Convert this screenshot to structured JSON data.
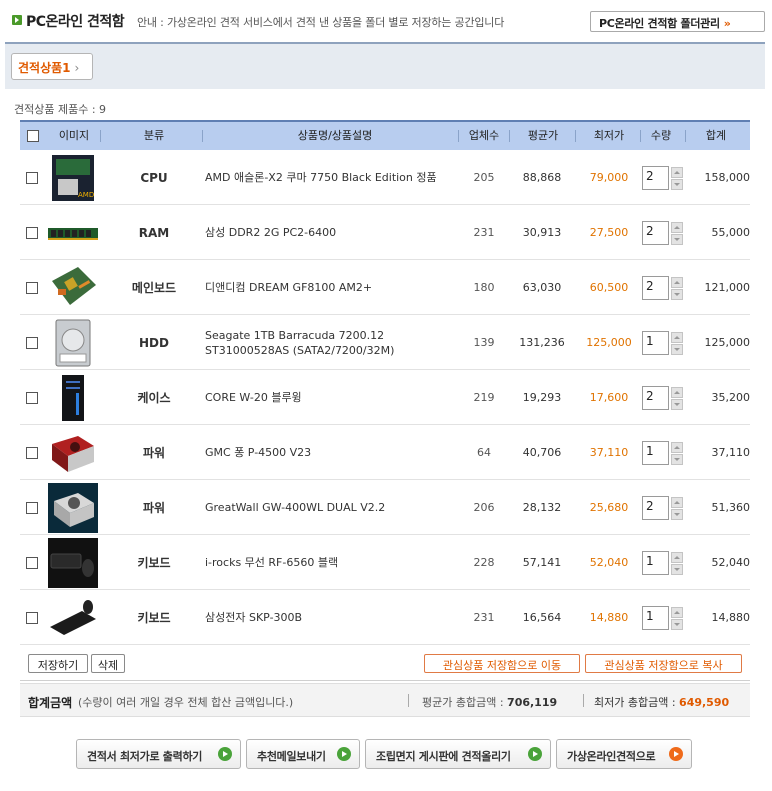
{
  "header": {
    "title": "PC온라인 견적함",
    "notice": "안내 : 가상온라인 견적 서비스에서 견적 낸 상품을 폴더 별로 저장하는 공간입니다",
    "folder_button": "PC온라인 견적함 폴더관리",
    "folder_button_chevron": "»"
  },
  "tabs": [
    {
      "label": "견적상품1",
      "chevron": "›",
      "active": true
    }
  ],
  "count_label": "견적상품 제품수 : 9",
  "table": {
    "columns": [
      "이미지",
      "분류",
      "상품명/상품설명",
      "업체수",
      "평균가",
      "최저가",
      "수량",
      "합계"
    ],
    "rows": [
      {
        "image": "cpu-box-image",
        "category": "CPU",
        "name": "AMD 애슬론-X2 쿠마 7750 Black Edition 정품",
        "vendors": "205",
        "avg": "88,868",
        "low": "79,000",
        "qty": "2",
        "total": "158,000"
      },
      {
        "image": "ram-stick-image",
        "category": "RAM",
        "name": "삼성 DDR2 2G PC2-6400",
        "vendors": "231",
        "avg": "30,913",
        "low": "27,500",
        "qty": "2",
        "total": "55,000"
      },
      {
        "image": "mainboard-image",
        "category": "메인보드",
        "name": "디앤디컴 DREAM GF8100 AM2+",
        "vendors": "180",
        "avg": "63,030",
        "low": "60,500",
        "qty": "2",
        "total": "121,000"
      },
      {
        "image": "hdd-image",
        "category": "HDD",
        "name": "Seagate 1TB Barracuda 7200.12 ST31000528AS (SATA2/7200/32M)",
        "vendors": "139",
        "avg": "131,236",
        "low": "125,000",
        "qty": "1",
        "total": "125,000"
      },
      {
        "image": "pc-case-image",
        "category": "케이스",
        "name": "CORE W-20 블루윙",
        "vendors": "219",
        "avg": "19,293",
        "low": "17,600",
        "qty": "2",
        "total": "35,200"
      },
      {
        "image": "psu-image",
        "category": "파워",
        "name": "GMC 퐁 P-4500 V23",
        "vendors": "64",
        "avg": "40,706",
        "low": "37,110",
        "qty": "1",
        "total": "37,110"
      },
      {
        "image": "psu-image-2",
        "category": "파워",
        "name": "GreatWall GW-400WL DUAL V2.2",
        "vendors": "206",
        "avg": "28,132",
        "low": "25,680",
        "qty": "2",
        "total": "51,360"
      },
      {
        "image": "keyboard-mouse-image",
        "category": "키보드",
        "name": "i-rocks 무선 RF-6560 블랙",
        "vendors": "228",
        "avg": "57,141",
        "low": "52,040",
        "qty": "1",
        "total": "52,040"
      },
      {
        "image": "keyboard-image",
        "category": "키보드",
        "name": "삼성전자 SKP-300B",
        "vendors": "231",
        "avg": "16,564",
        "low": "14,880",
        "qty": "1",
        "total": "14,880"
      }
    ]
  },
  "actions": {
    "save": "저장하기",
    "delete": "삭제",
    "move": "관심상품 저장함으로 이동",
    "copy": "관심상품 저장함으로 복사"
  },
  "summary": {
    "label": "합계금액",
    "note": "(수량이 여러 개일 경우 전체 합산 금액입니다.)",
    "avg_label": "평균가 총합금액 : ",
    "avg_value": "706,119",
    "low_label": "최저가 총합금액 : ",
    "low_value": "649,590"
  },
  "bottom_buttons": [
    {
      "label": "견적서 최저가로 출력하기",
      "accent": "green"
    },
    {
      "label": "추천메일보내기",
      "accent": "green"
    },
    {
      "label": "조립면지 게시판에 견적올리기",
      "accent": "green"
    },
    {
      "label": "가상온라인견적으로",
      "accent": "orange"
    }
  ],
  "colors": {
    "accent_orange": "#e05a00",
    "header_blue": "#b8cdef",
    "go_green": "#4aa33a"
  }
}
